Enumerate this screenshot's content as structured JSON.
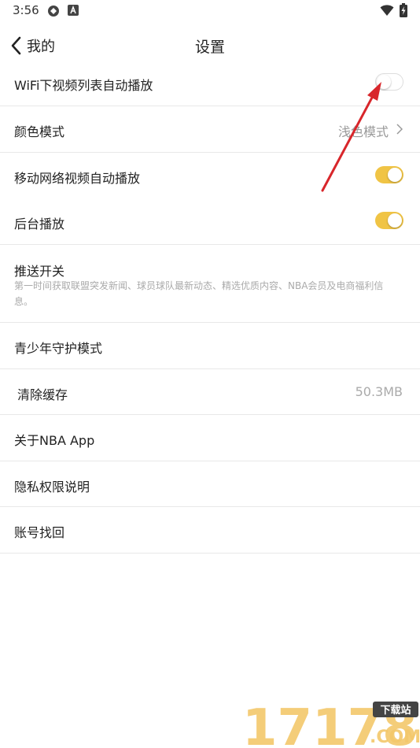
{
  "status": {
    "time": "3:56"
  },
  "header": {
    "back_label": "我的",
    "title": "设置"
  },
  "settings": {
    "wifi_autoplay": {
      "label": "WiFi下视频列表自动播放",
      "enabled": false
    },
    "color_mode": {
      "label": "颜色模式",
      "value": "浅色模式"
    },
    "mobile_autoplay": {
      "label": "移动网络视频自动播放",
      "enabled": true
    },
    "background_play": {
      "label": "后台播放",
      "enabled": true
    },
    "push": {
      "label": "推送开关",
      "description": "第一时间获取联盟突发新闻、球员球队最新动态、精选优质内容、NBA会员及电商福利信息。"
    },
    "youth_mode": {
      "label": "青少年守护模式"
    },
    "clear_cache": {
      "label": "清除缓存",
      "value": "50.3MB"
    },
    "about": {
      "label": "关于NBA App"
    },
    "privacy": {
      "label": "隐私权限说明"
    },
    "account_recovery": {
      "label": "账号找回"
    }
  },
  "watermark": {
    "number": "17178",
    "badge": "下载站",
    "domain": ".COM"
  },
  "colors": {
    "toggle_on": "#f0c445",
    "annotation_arrow": "#d8262b"
  }
}
